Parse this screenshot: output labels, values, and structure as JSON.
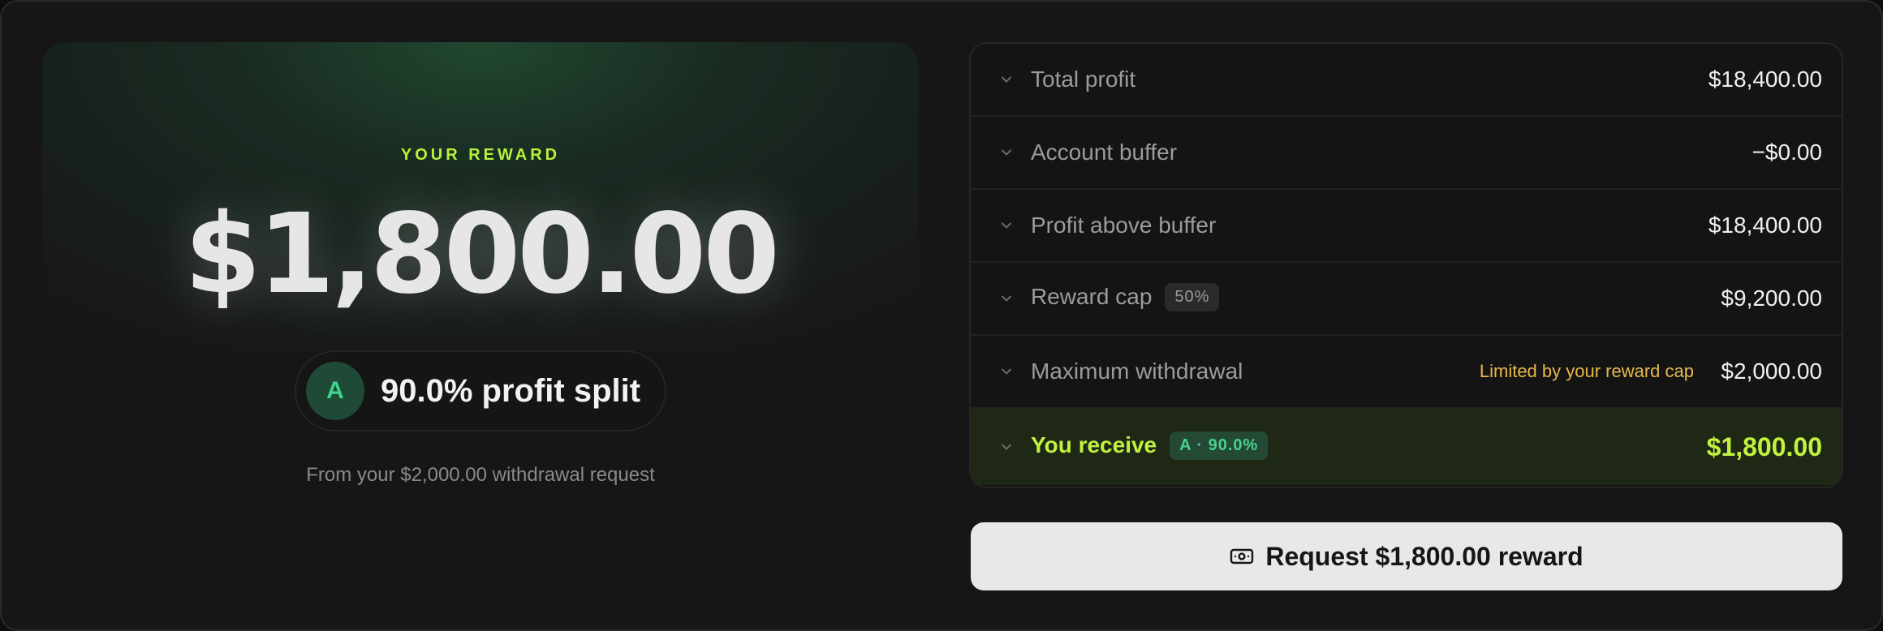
{
  "hero": {
    "label": "YOUR REWARD",
    "amount": "$1,800.00",
    "avatar_letter": "A",
    "split_text": "90.0% profit split",
    "from_text": "From your $2,000.00 withdrawal request"
  },
  "breakdown": {
    "rows": [
      {
        "label": "Total profit",
        "value": "$18,400.00"
      },
      {
        "label": "Account buffer",
        "value": "−$0.00"
      },
      {
        "label": "Profit above buffer",
        "value": "$18,400.00"
      },
      {
        "label": "Reward cap",
        "badge": "50%",
        "value": "$9,200.00"
      },
      {
        "label": "Maximum withdrawal",
        "note": "Limited by your reward cap",
        "value": "$2,000.00"
      }
    ],
    "receive": {
      "label": "You receive",
      "badge": "A · 90.0%",
      "value": "$1,800.00"
    }
  },
  "action": {
    "label": "Request $1,800.00 reward",
    "icon": "cash-icon"
  },
  "colors": {
    "accent_lime": "#c2f240",
    "accent_green": "#3fd38d",
    "warning": "#e8b84a"
  }
}
